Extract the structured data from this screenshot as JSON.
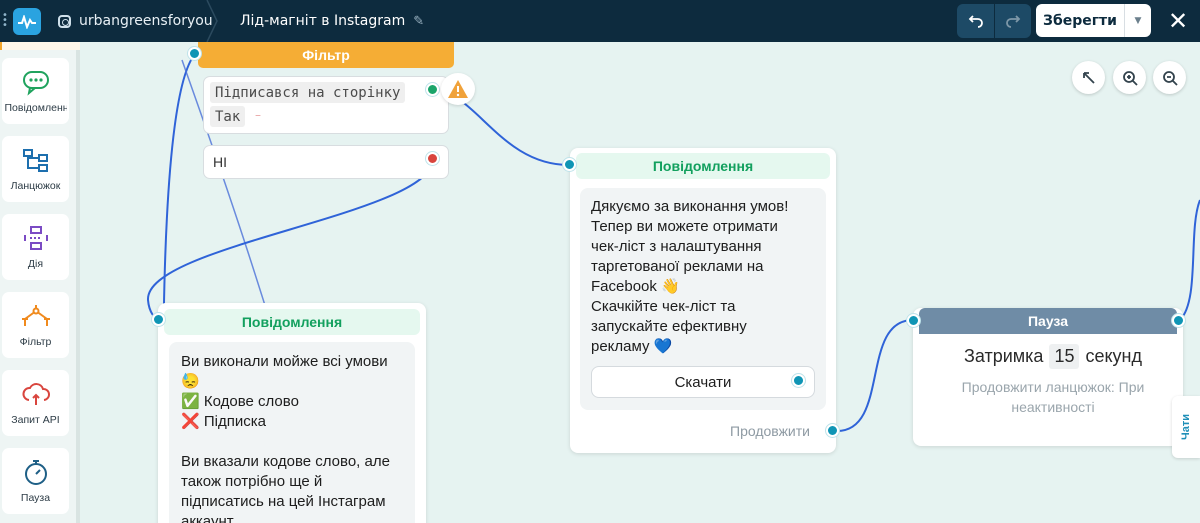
{
  "header": {
    "account_name": "urbangreensforyou",
    "flow_title": "Лід-магніт в Instagram",
    "save_label": "Зберегти",
    "close_glyph": "✕"
  },
  "sidebar": {
    "items": [
      {
        "label": "Повідомлення",
        "icon": "chat-bubble-icon"
      },
      {
        "label": "Ланцюжок",
        "icon": "chain-icon"
      },
      {
        "label": "Дія",
        "icon": "action-icon"
      },
      {
        "label": "Фільтр",
        "icon": "filter-icon"
      },
      {
        "label": "Запит API",
        "icon": "api-cloud-icon"
      },
      {
        "label": "Пауза",
        "icon": "stopwatch-icon"
      }
    ]
  },
  "nodes": {
    "filter": {
      "title": "Фільтр",
      "condition": "Підписався на сторінку",
      "value": "Так",
      "no_branch": "НІ"
    },
    "message_left": {
      "title": "Повідомлення",
      "lines": [
        "Ви виконали мойже всі умови",
        "😓",
        "✅ Кодове слово",
        "❌ Підписка",
        "",
        "Ви вказали кодове слово, але",
        "також потрібно ще й",
        "підписатись на цей Інстаграм",
        "аккаунт"
      ]
    },
    "message_right": {
      "title": "Повідомлення",
      "lines": [
        "Дякуємо за виконання умов!",
        "Тепер ви можете отримати",
        "чек-ліст з налаштування",
        "таргетованої реклами на",
        "Facebook 👋",
        "Скачкійте чек-ліст та",
        "запускайте ефективну",
        "рекламу 💙"
      ],
      "button_label": "Скачати",
      "continue_label": "Продовжити"
    },
    "pause": {
      "title": "Пауза",
      "delay_prefix": "Затримка",
      "delay_value": "15",
      "delay_unit": "секунд",
      "subtitle": "Продовжити ланцюжок: При неактивності"
    }
  },
  "chats_tab_label": "Чати",
  "colors": {
    "topbar": "#0d2b3e",
    "canvas": "#e6f3f1",
    "filter_accent": "#f5ad35",
    "message_accent": "#12a05e",
    "pause_accent": "#6f8ca6",
    "port": "#0f95b5",
    "wire": "#2f63d8"
  }
}
